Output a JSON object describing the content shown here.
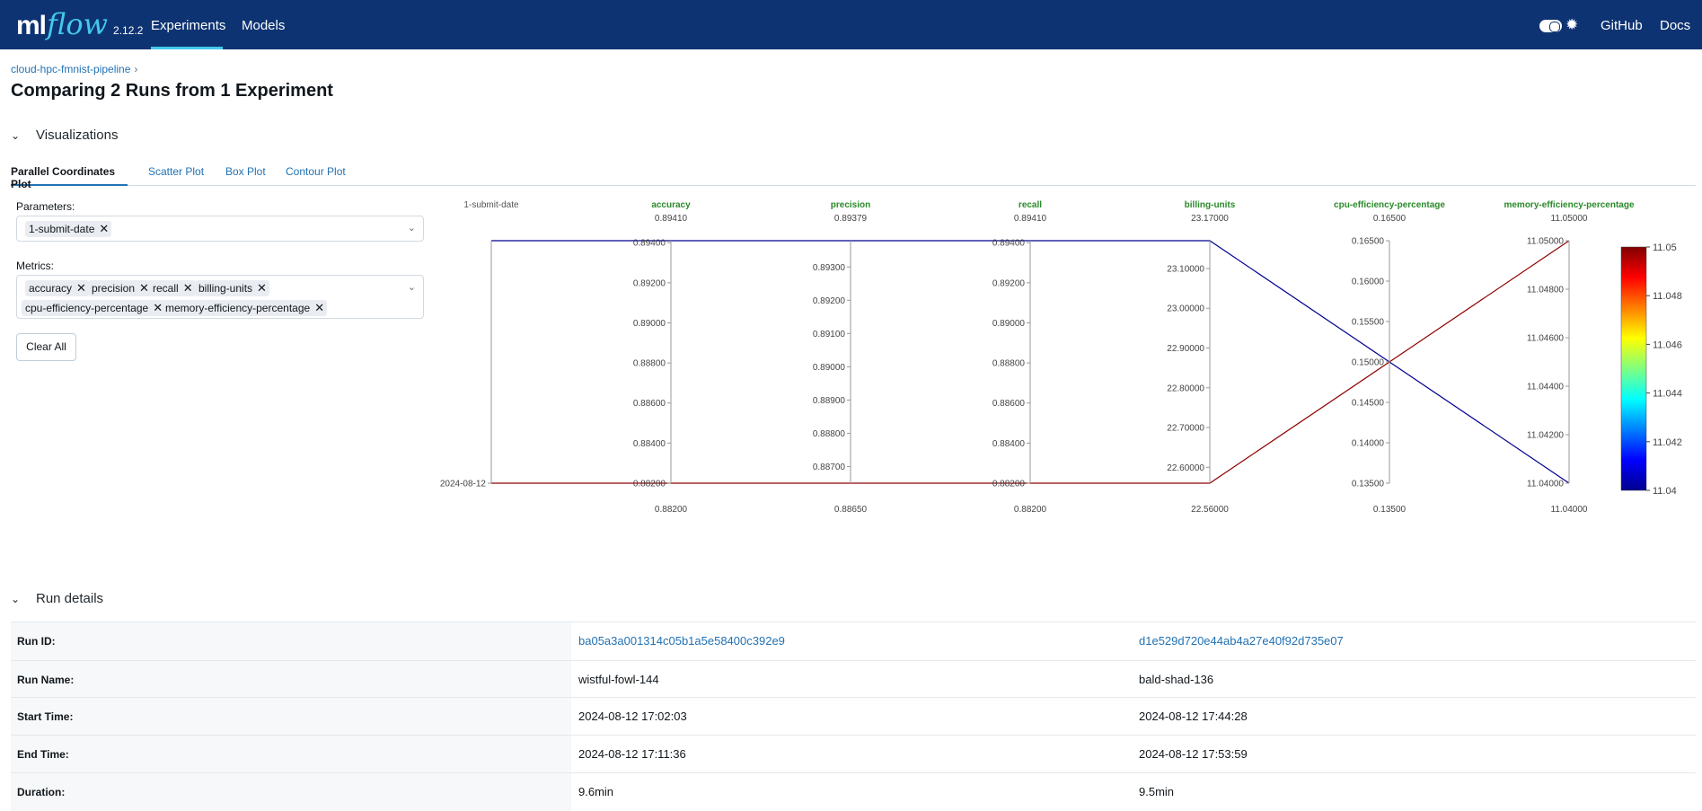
{
  "header": {
    "logo_ml": "ml",
    "logo_flow": "flow",
    "version": "2.12.2",
    "nav": [
      "Experiments",
      "Models"
    ],
    "github": "GitHub",
    "docs": "Docs",
    "theme_icon": "sun-icon"
  },
  "breadcrumb": {
    "experiment": "cloud-hpc-fmnist-pipeline",
    "separator": "›"
  },
  "title": "Comparing 2 Runs from 1 Experiment",
  "visualizations": {
    "heading": "Visualizations",
    "tabs": [
      "Parallel Coordinates Plot",
      "Scatter Plot",
      "Box Plot",
      "Contour Plot"
    ],
    "parameters_label": "Parameters:",
    "parameters": [
      "1-submit-date"
    ],
    "metrics_label": "Metrics:",
    "metrics": [
      "accuracy",
      "precision",
      "recall",
      "billing-units",
      "cpu-efficiency-percentage",
      "memory-efficiency-percentage"
    ],
    "clear_all": "Clear All"
  },
  "chart_data": {
    "type": "parallel_coordinates",
    "axes": [
      {
        "name": "1-submit-date",
        "kind": "param",
        "top_label": "",
        "bottom_label": "",
        "ticks": [
          "2024-08-12"
        ],
        "min": null,
        "max": null
      },
      {
        "name": "accuracy",
        "kind": "metric",
        "top_label": "0.89410",
        "bottom_label": "0.88200",
        "min": 0.882,
        "max": 0.8941,
        "ticks": [
          "0.89400",
          "0.89200",
          "0.89000",
          "0.88800",
          "0.88600",
          "0.88400",
          "0.88200"
        ]
      },
      {
        "name": "precision",
        "kind": "metric",
        "top_label": "0.89379",
        "bottom_label": "0.88650",
        "min": 0.8865,
        "max": 0.89379,
        "ticks": [
          "0.89300",
          "0.89200",
          "0.89100",
          "0.89000",
          "0.88900",
          "0.88800",
          "0.88700"
        ]
      },
      {
        "name": "recall",
        "kind": "metric",
        "top_label": "0.89410",
        "bottom_label": "0.88200",
        "min": 0.882,
        "max": 0.8941,
        "ticks": [
          "0.89400",
          "0.89200",
          "0.89000",
          "0.88800",
          "0.88600",
          "0.88400",
          "0.88200"
        ]
      },
      {
        "name": "billing-units",
        "kind": "metric",
        "top_label": "23.17000",
        "bottom_label": "22.56000",
        "min": 22.56,
        "max": 23.17,
        "ticks": [
          "23.10000",
          "23.00000",
          "22.90000",
          "22.80000",
          "22.70000",
          "22.60000"
        ]
      },
      {
        "name": "cpu-efficiency-percentage",
        "kind": "metric",
        "top_label": "0.16500",
        "bottom_label": "0.13500",
        "min": 0.135,
        "max": 0.165,
        "ticks": [
          "0.16500",
          "0.16000",
          "0.15500",
          "0.15000",
          "0.14500",
          "0.14000",
          "0.13500"
        ]
      },
      {
        "name": "memory-efficiency-percentage",
        "kind": "metric",
        "top_label": "11.05000",
        "bottom_label": "11.04000",
        "min": 11.04,
        "max": 11.05,
        "ticks": [
          "11.05000",
          "11.04800",
          "11.04600",
          "11.04400",
          "11.04200",
          "11.04000"
        ]
      }
    ],
    "runs": [
      {
        "values": [
          "2024-08-12",
          0.8941,
          0.89379,
          0.8941,
          23.17,
          0.15,
          11.04
        ],
        "color": "#00008f"
      },
      {
        "values": [
          "2024-08-12",
          0.882,
          0.8865,
          0.882,
          22.56,
          0.15,
          11.05
        ],
        "color": "#8f0000"
      }
    ],
    "colorbar": {
      "ticks": [
        "11.05",
        "11.048",
        "11.046",
        "11.044",
        "11.042",
        "11.04"
      ],
      "min": 11.04,
      "max": 11.05
    }
  },
  "run_details": {
    "heading": "Run details",
    "rows": [
      {
        "label": "Run ID:",
        "values": [
          "ba05a3a001314c05b1a5e58400c392e9",
          "d1e529d720e44ab4a27e40f92d735e07"
        ],
        "link": true
      },
      {
        "label": "Run Name:",
        "values": [
          "wistful-fowl-144",
          "bald-shad-136"
        ],
        "link": false
      },
      {
        "label": "Start Time:",
        "values": [
          "2024-08-12 17:02:03",
          "2024-08-12 17:44:28"
        ],
        "link": false
      },
      {
        "label": "End Time:",
        "values": [
          "2024-08-12 17:11:36",
          "2024-08-12 17:53:59"
        ],
        "link": false
      },
      {
        "label": "Duration:",
        "values": [
          "9.6min",
          "9.5min"
        ],
        "link": false
      }
    ]
  }
}
